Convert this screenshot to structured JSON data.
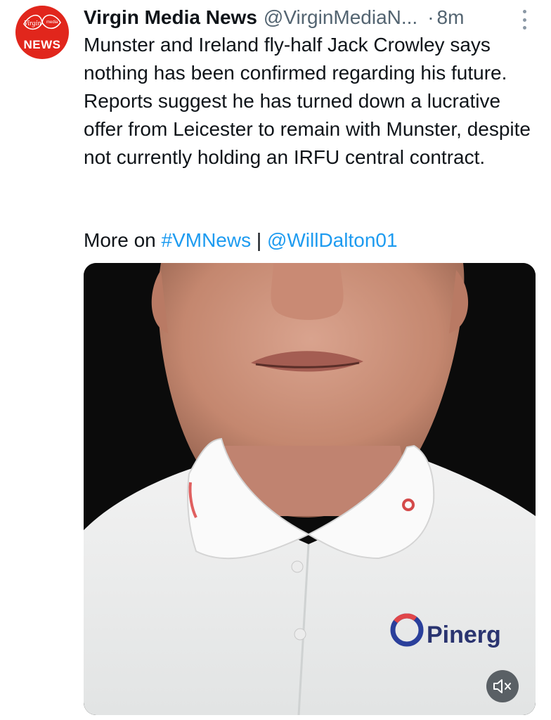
{
  "tweet": {
    "author_name": "Virgin Media News",
    "author_handle": "@VirginMediaN...",
    "separator": "·",
    "timestamp": "8m",
    "avatar": {
      "logo_text": "Virgin",
      "logo_sub": "media",
      "badge_text": "NEWS",
      "brand_color": "#e1261c"
    },
    "text": "Munster and Ireland fly-half Jack Crowley says nothing has been confirmed regarding his future. Reports suggest he has turned down a lucrative offer from Leicester to remain with Munster, despite not currently holding an IRFU central contract.",
    "more_prefix": "More on",
    "hashtag": "#VMNews",
    "pipe": "|",
    "mention": "@WillDalton01",
    "link_color": "#1d9bf0",
    "more_options_icon": "vertical-dots-icon"
  },
  "media": {
    "type": "video",
    "shirt_logo_text": "Pinerg",
    "mute_icon": "speaker-muted-icon"
  }
}
